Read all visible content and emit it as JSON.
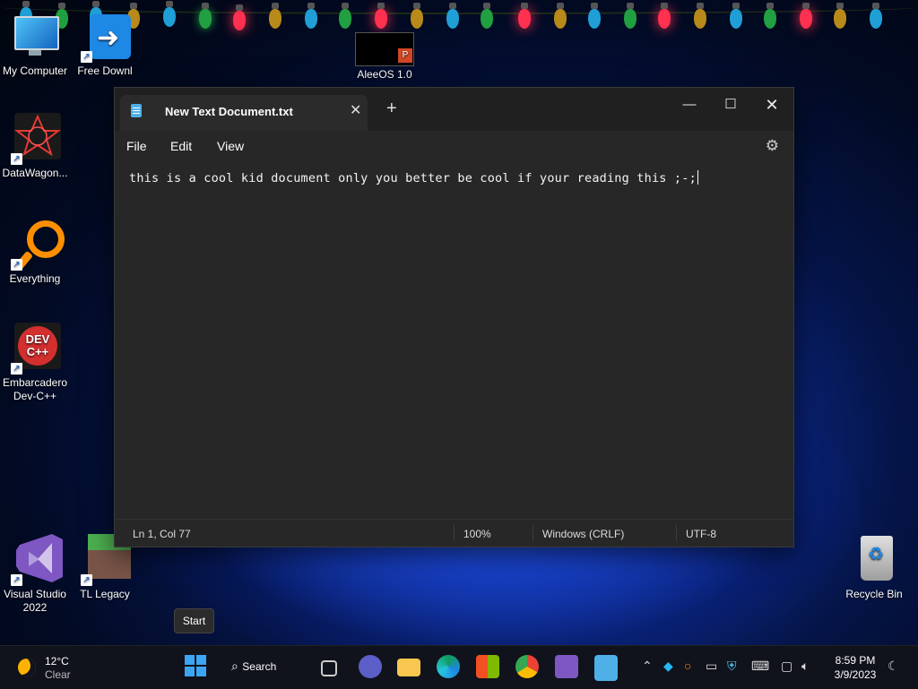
{
  "desktop": {
    "icons": [
      {
        "label": "My Computer"
      },
      {
        "label": "Free Downl"
      },
      {
        "label": "AleeOS 1.0"
      },
      {
        "label": "DataWagon..."
      },
      {
        "label": "Everything"
      },
      {
        "label": "Embarcadero Dev-C++"
      },
      {
        "label": "Visual Studio 2022"
      },
      {
        "label": "TL Legacy"
      },
      {
        "label": "Recycle Bin"
      }
    ],
    "icon_glyphs": {
      "devcpp": "DEV C++"
    }
  },
  "notepad": {
    "tab_title": "New Text Document.txt",
    "new_tab": "+",
    "menu": [
      "File",
      "Edit",
      "View"
    ],
    "content": "this is a cool kid document only you better be cool if your reading this ;-;",
    "status": {
      "position": "Ln 1, Col 77",
      "zoom": "100%",
      "line_ending": "Windows (CRLF)",
      "encoding": "UTF-8"
    }
  },
  "tooltip": "Start",
  "taskbar": {
    "weather_temp": "12°C",
    "weather_desc": "Clear",
    "search_label": "Search",
    "time": "8:59 PM",
    "date": "3/9/2023"
  },
  "colors": {
    "accent": "#4fb0e8",
    "window_bg": "#272727",
    "taskbar_bg": "#10131c"
  }
}
